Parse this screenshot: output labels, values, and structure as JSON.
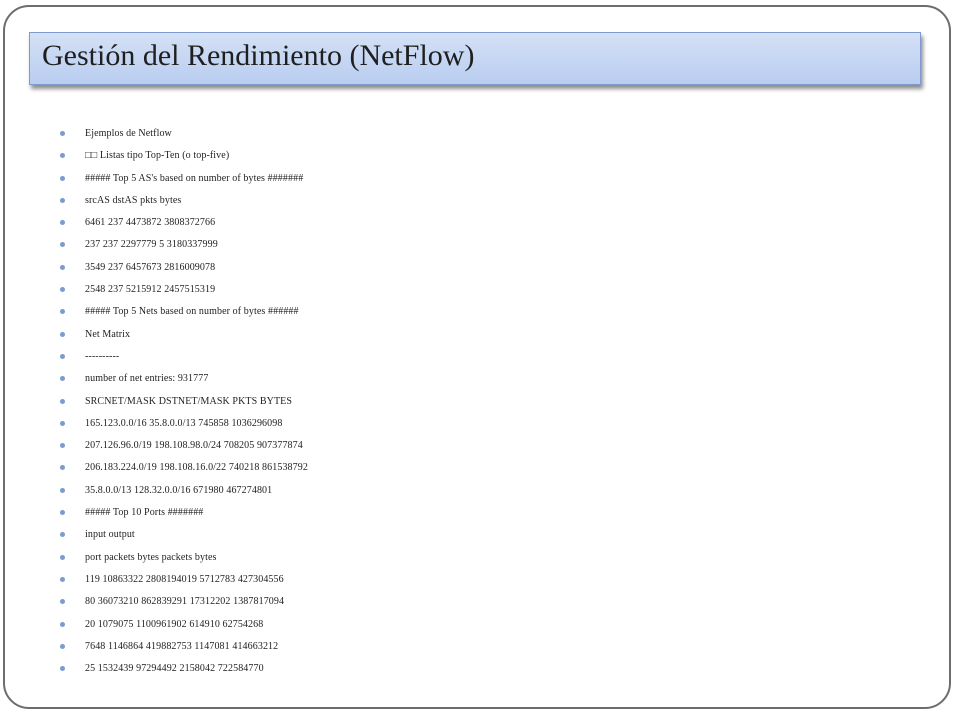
{
  "slide": {
    "title": "Gestión del Rendimiento (NetFlow)",
    "bullets": [
      "Ejemplos de Netflow",
      "□□ Listas tipo Top-Ten (o top-five)",
      "##### Top 5 AS's based on number of bytes #######",
      "srcAS dstAS pkts bytes",
      "6461 237 4473872 3808372766",
      "237 237 2297779 5 3180337999",
      "3549 237 6457673 2816009078",
      "2548 237 5215912 2457515319",
      "##### Top 5 Nets based on number of bytes ######",
      "Net Matrix",
      "----------",
      "number of net entries: 931777",
      "SRCNET/MASK DSTNET/MASK PKTS BYTES",
      "165.123.0.0/16 35.8.0.0/13 745858 1036296098",
      "207.126.96.0/19 198.108.98.0/24 708205 907377874",
      "206.183.224.0/19 198.108.16.0/22 740218 861538792",
      "35.8.0.0/13 128.32.0.0/16 671980 467274801",
      "##### Top 10 Ports #######",
      "input output",
      "port packets bytes packets bytes",
      "119 10863322 2808194019 5712783 427304556",
      "80 36073210 862839291 17312202 1387817094",
      "20 1079075 1100961902 614910 62754268",
      "7648 1146864 419882753 1147081 414663212",
      "25 1532439 97294492 2158042 722584770"
    ]
  },
  "colors": {
    "title_bg": "#c6d6f3",
    "title_border": "#7f9ad0",
    "bullet": "#7a9bd0",
    "frame": "#6d6d6d"
  }
}
